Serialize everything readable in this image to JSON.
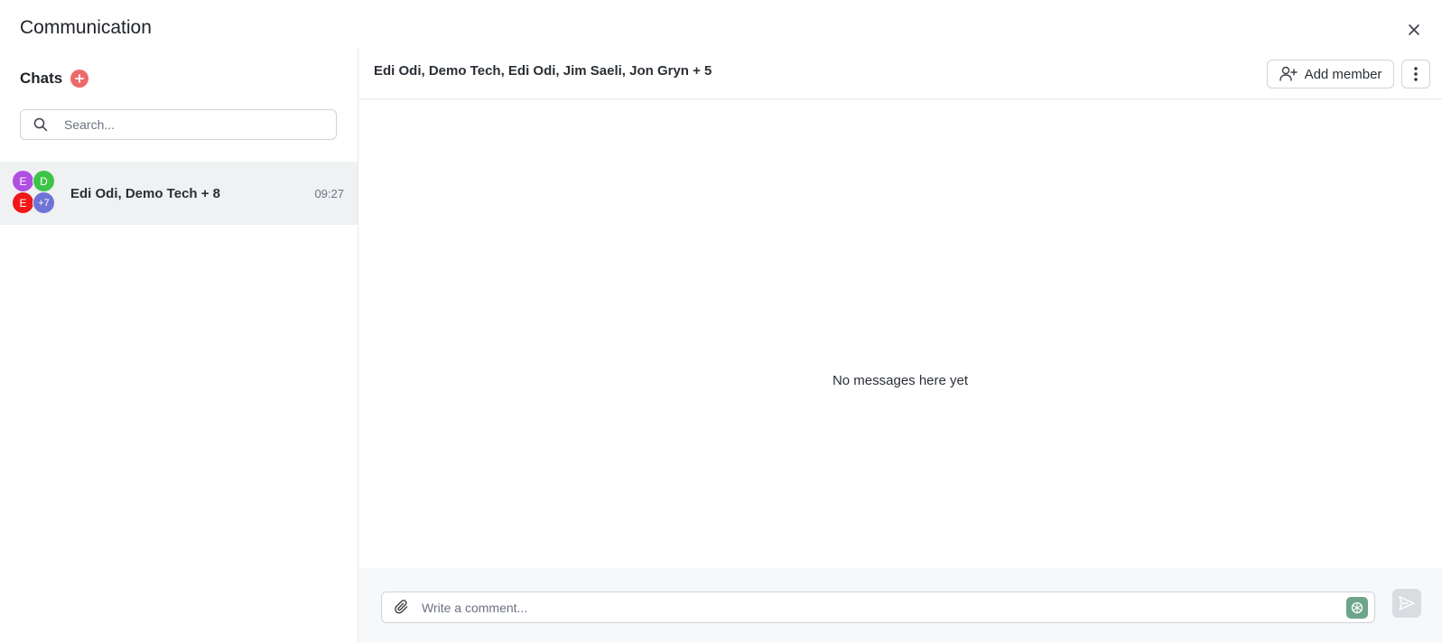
{
  "app": {
    "title": "Communication"
  },
  "sidebar": {
    "title": "Chats",
    "add_icon": "plus-icon",
    "search": {
      "placeholder": "Search...",
      "value": ""
    },
    "chats": [
      {
        "name": "Edi Odi, Demo Tech + 8",
        "time": "09:27",
        "avatars": [
          {
            "label": "E",
            "color": "#b04fe0"
          },
          {
            "label": "D",
            "color": "#3fc44a"
          },
          {
            "label": "E",
            "color": "#f01818"
          },
          {
            "label": "+7",
            "color": "#6f73d6"
          }
        ]
      }
    ]
  },
  "conversation": {
    "title": "Edi Odi, Demo Tech, Edi Odi, Jim Saeli, Jon Gryn + 5",
    "add_member_label": "Add member",
    "empty_text": "No messages here yet",
    "composer": {
      "placeholder": "Write a comment...",
      "value": ""
    }
  },
  "colors": {
    "accent_red": "#ee6a6a",
    "ai_green": "#6da58a",
    "selected_bg": "#f0f1f3"
  }
}
